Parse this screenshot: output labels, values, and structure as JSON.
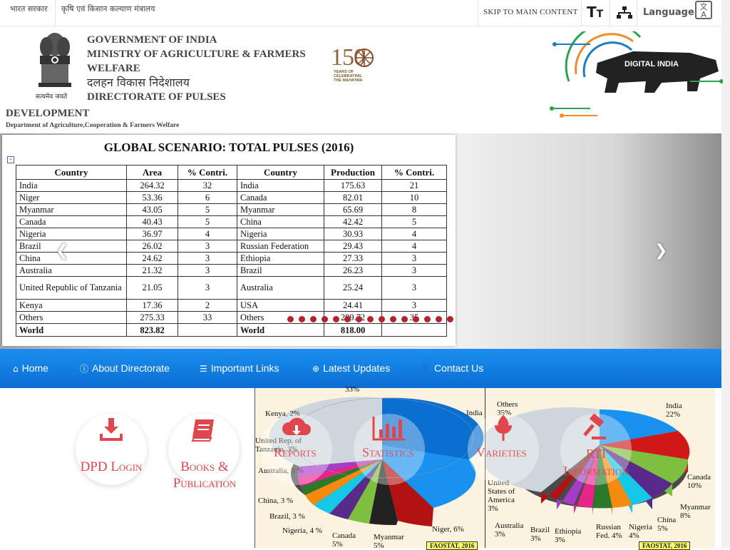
{
  "topbar": {
    "gov_hindi": "भारत सरकार",
    "ministry_hindi": "कृषि एवं किसान कल्याण मंत्रालय",
    "skip_link": "SKIP TO MAIN CONTENT",
    "text_size_icon": "text-size-icon",
    "sitemap_icon": "sitemap-icon",
    "language_label": "Language",
    "language_icon": "language-translate-icon"
  },
  "header": {
    "line1": "GOVERNMENT OF INDIA",
    "line2": "MINISTRY OF AGRICULTURE & FARMERS",
    "line3": "WELFARE",
    "hindi_title": "दलहन विकास निदेशालय",
    "line5": "DIRECTORATE OF PULSES",
    "line6": "DEVELOPMENT",
    "dept": "Department of Agriculture,Cooperation & Farmers Welfare",
    "emblem_motto": "सत्यमेव जयते",
    "logo150_main": "150",
    "logo150_sub": "YEARS OF CELEBRATING THE MAHATMA",
    "digital_india": "DIGITAL INDIA"
  },
  "slide": {
    "title": "GLOBAL SCENARIO: TOTAL PULSES (2016)",
    "headers": [
      "Country",
      "Area",
      "% Contri.",
      "Country",
      "Production",
      "% Contri."
    ],
    "rows": [
      [
        "India",
        "264.32",
        "32",
        "India",
        "175.63",
        "21"
      ],
      [
        "Niger",
        "53.36",
        "6",
        "Canada",
        "82.01",
        "10"
      ],
      [
        "Myanmar",
        "43.05",
        "5",
        "Myanmar",
        "65.69",
        "8"
      ],
      [
        "Canada",
        "40.43",
        "5",
        "China",
        "42.42",
        "5"
      ],
      [
        "Nigeria",
        "36.97",
        "4",
        "Nigeria",
        "30.93",
        "4"
      ],
      [
        "Brazil",
        "26.02",
        "3",
        "Russian Federation",
        "29.43",
        "4"
      ],
      [
        "China",
        "24.62",
        "3",
        "Ethiopia",
        "27.33",
        "3"
      ],
      [
        "Australia",
        "21.32",
        "3",
        "Brazil",
        "26.23",
        "3"
      ],
      [
        "United Republic of Tanzania",
        "21.05",
        "3",
        "Australia",
        "25.24",
        "3"
      ],
      [
        "Kenya",
        "17.36",
        "2",
        "USA",
        "24.41",
        "3"
      ],
      [
        "Others",
        "275.33",
        "33",
        "Others",
        "289.72",
        "35"
      ]
    ],
    "total": [
      "World",
      "823.82",
      "",
      "World",
      "818.00",
      ""
    ],
    "prev_icon": "chevron-left-icon",
    "next_icon": "chevron-right-icon",
    "indicator_count": 15
  },
  "nav": {
    "items": [
      {
        "label": "Home",
        "icon": "home-icon"
      },
      {
        "label": "About Directorate",
        "icon": "info-circle-icon"
      },
      {
        "label": "Important Links",
        "icon": "list-icon"
      },
      {
        "label": "Latest Updates",
        "icon": "search-plus-icon"
      },
      {
        "label": "Contact Us",
        "icon": "user-icon"
      }
    ]
  },
  "quicklinks": [
    {
      "label": "DPD Login",
      "icon": "download-icon"
    },
    {
      "label": "Books & Publication",
      "icon": "book-icon"
    },
    {
      "label": "Reports",
      "icon": "cloud-download-icon"
    },
    {
      "label": "Statistics",
      "icon": "bar-chart-icon"
    },
    {
      "label": "Varieties",
      "icon": "leaf-icon"
    },
    {
      "label": "RTI Information",
      "icon": "gavel-icon"
    }
  ],
  "pie_area": {
    "labels": [
      {
        "text": "33%"
      },
      {
        "text": "Kenya, 2%"
      },
      {
        "text": "India"
      },
      {
        "text": "United Rep. of Tanzania, 3%"
      },
      {
        "text": "Australia, 3 %"
      },
      {
        "text": "China, 3 %"
      },
      {
        "text": "Brazil, 3 %"
      },
      {
        "text": "Nigeria, 4 %"
      },
      {
        "text": "Canada 5%"
      },
      {
        "text": "Myanmar 5%"
      },
      {
        "text": "Niger, 6%"
      }
    ],
    "source": "FAOSTAT, 2016"
  },
  "pie_prod": {
    "labels": [
      {
        "text": "Others 35%"
      },
      {
        "text": "India 22%"
      },
      {
        "text": "Canada 10%"
      },
      {
        "text": "Myanmar 8%"
      },
      {
        "text": "China 5%"
      },
      {
        "text": "Nigeria 4%"
      },
      {
        "text": "Russian Fed. 4%"
      },
      {
        "text": "Ethiopia 3%"
      },
      {
        "text": "Brazil 3%"
      },
      {
        "text": "Australia 3%"
      },
      {
        "text": "United States of America 3%"
      }
    ],
    "source": "FAOSTAT, 2016"
  },
  "colors": {
    "nav_blue": "#0f7fe6",
    "accent_red": "#e0464d",
    "dot_red": "#b5232f"
  }
}
